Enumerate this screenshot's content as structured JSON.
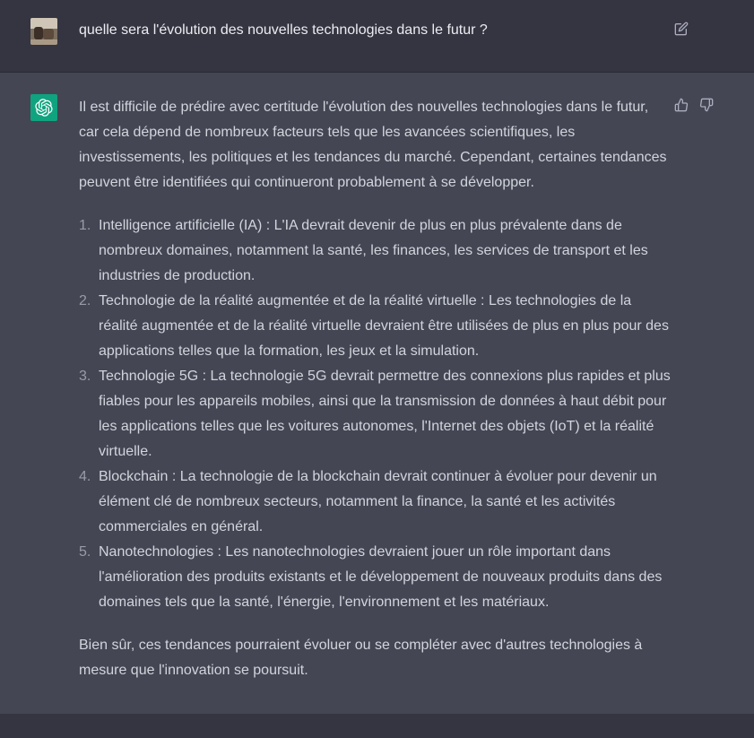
{
  "user_message": {
    "text": "quelle sera l'évolution des nouvelles technologies dans le futur ?"
  },
  "assistant_message": {
    "intro": "Il est difficile de prédire avec certitude l'évolution des nouvelles technologies dans le futur, car cela dépend de nombreux facteurs tels que les avancées scientifiques, les investissements, les politiques et les tendances du marché. Cependant, certaines tendances peuvent être identifiées qui continueront probablement à se développer.",
    "items": [
      {
        "num": "1.",
        "text": "Intelligence artificielle (IA) : L'IA devrait devenir de plus en plus prévalente dans de nombreux domaines, notamment la santé, les finances, les services de transport et les industries de production."
      },
      {
        "num": "2.",
        "text": "Technologie de la réalité augmentée et de la réalité virtuelle : Les technologies de la réalité augmentée et de la réalité virtuelle devraient être utilisées de plus en plus pour des applications telles que la formation, les jeux et la simulation."
      },
      {
        "num": "3.",
        "text": "Technologie 5G : La technologie 5G devrait permettre des connexions plus rapides et plus fiables pour les appareils mobiles, ainsi que la transmission de données à haut débit pour les applications telles que les voitures autonomes, l'Internet des objets (IoT) et la réalité virtuelle."
      },
      {
        "num": "4.",
        "text": "Blockchain : La technologie de la blockchain devrait continuer à évoluer pour devenir un élément clé de nombreux secteurs, notamment la finance, la santé et les activités commerciales en général."
      },
      {
        "num": "5.",
        "text": "Nanotechnologies : Les nanotechnologies devraient jouer un rôle important dans l'amélioration des produits existants et le développement de nouveaux produits dans des domaines tels que la santé, l'énergie, l'environnement et les matériaux."
      }
    ],
    "conclusion": "Bien sûr, ces tendances pourraient évoluer ou se compléter avec d'autres technologies à mesure que l'innovation se poursuit."
  },
  "icons": {
    "edit": "edit-icon",
    "thumbs_up": "thumbs-up-icon",
    "thumbs_down": "thumbs-down-icon",
    "assistant_logo": "openai-logo-icon"
  },
  "colors": {
    "user_bg": "#343541",
    "assistant_bg": "#444654",
    "assistant_avatar": "#10a37f",
    "text": "#d1d5db"
  }
}
